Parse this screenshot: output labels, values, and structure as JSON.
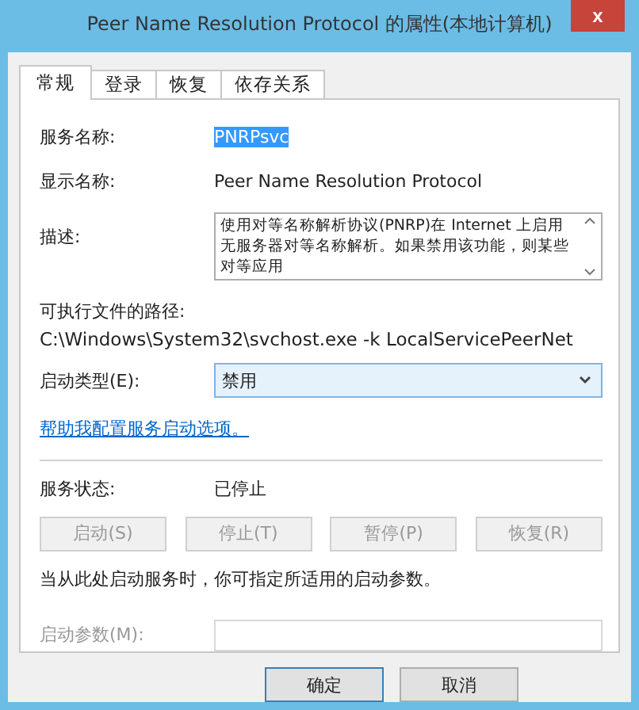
{
  "window": {
    "title": "Peer Name Resolution Protocol 的属性(本地计算机)",
    "close": "x"
  },
  "tabs": [
    {
      "label": "常规",
      "selected": true
    },
    {
      "label": "登录",
      "selected": false
    },
    {
      "label": "恢复",
      "selected": false
    },
    {
      "label": "依存关系",
      "selected": false
    }
  ],
  "service_name": {
    "label": "服务名称:",
    "value": "PNRPsvc",
    "highlighted": true
  },
  "display_name": {
    "label": "显示名称:",
    "value": "Peer Name Resolution Protocol"
  },
  "description": {
    "label": "描述:",
    "value": "使用对等名称解析协议(PNRP)在 Internet 上启用无服务器对等名称解析。如果禁用该功能，则某些对等应用"
  },
  "path": {
    "label": "可执行文件的路径:",
    "value": "C:\\Windows\\System32\\svchost.exe -k LocalServicePeerNet"
  },
  "startup_type": {
    "label": "启动类型(E):",
    "value": "禁用"
  },
  "help_link": "帮助我配置服务启动选项。",
  "service_status": {
    "label": "服务状态:",
    "value": "已停止"
  },
  "control_buttons": [
    {
      "label": "启动(S)",
      "disabled": true
    },
    {
      "label": "停止(T)",
      "disabled": true
    },
    {
      "label": "暂停(P)",
      "disabled": true
    },
    {
      "label": "恢复(R)",
      "disabled": true
    }
  ],
  "hint": "当从此处启动服务时，你可指定所适用的启动参数。",
  "start_params": {
    "label": "启动参数(M):",
    "disabled": true
  },
  "dialog_buttons": [
    {
      "label": "确定",
      "default": true
    },
    {
      "label": "取消",
      "default": false
    }
  ]
}
